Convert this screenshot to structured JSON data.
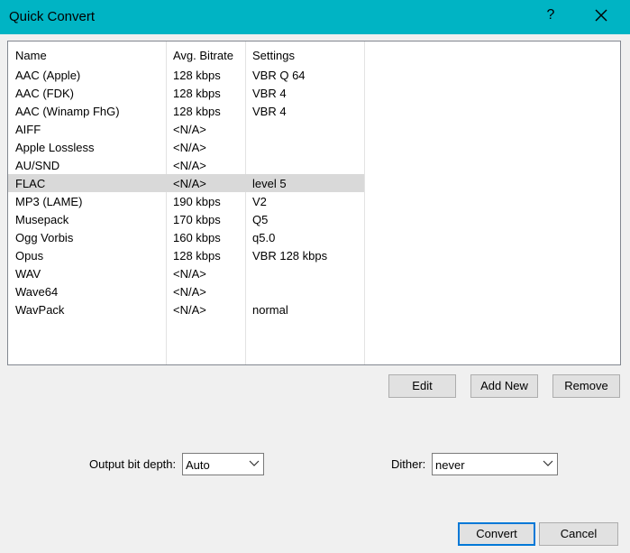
{
  "window": {
    "title": "Quick Convert",
    "help_glyph": "?"
  },
  "table": {
    "columns": [
      "Name",
      "Avg. Bitrate",
      "Settings"
    ],
    "selected_index": 6,
    "rows": [
      [
        "AAC (Apple)",
        "128 kbps",
        "VBR Q 64"
      ],
      [
        "AAC (FDK)",
        "128 kbps",
        "VBR 4"
      ],
      [
        "AAC (Winamp FhG)",
        "128 kbps",
        "VBR 4"
      ],
      [
        "AIFF",
        "<N/A>",
        ""
      ],
      [
        "Apple Lossless",
        "<N/A>",
        ""
      ],
      [
        "AU/SND",
        "<N/A>",
        ""
      ],
      [
        "FLAC",
        "<N/A>",
        "level 5"
      ],
      [
        "MP3 (LAME)",
        "190 kbps",
        "V2"
      ],
      [
        "Musepack",
        "170 kbps",
        "Q5"
      ],
      [
        "Ogg Vorbis",
        "160 kbps",
        "q5.0"
      ],
      [
        "Opus",
        "128 kbps",
        "VBR 128 kbps"
      ],
      [
        "WAV",
        "<N/A>",
        ""
      ],
      [
        "Wave64",
        "<N/A>",
        ""
      ],
      [
        "WavPack",
        "<N/A>",
        "normal"
      ]
    ]
  },
  "buttons": {
    "edit": "Edit",
    "add_new": "Add New",
    "remove": "Remove",
    "convert": "Convert",
    "cancel": "Cancel"
  },
  "output_bit_depth": {
    "label": "Output bit depth:",
    "value": "Auto"
  },
  "dither": {
    "label": "Dither:",
    "value": "never"
  },
  "colors": {
    "titlebar": "#00b4c4",
    "selection": "#d9d9d9",
    "default_button_border": "#0078d7"
  }
}
